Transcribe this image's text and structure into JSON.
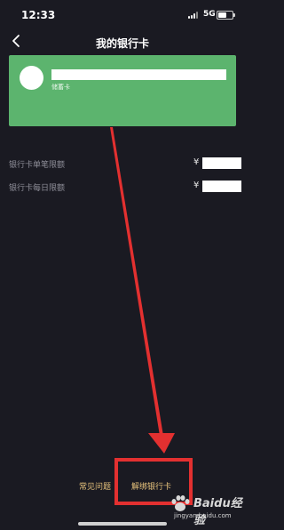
{
  "status_bar": {
    "time": "12:33",
    "network": "5G",
    "battery_level": 0.6
  },
  "nav": {
    "back_icon": "chevron-left-icon",
    "title": "我的银行卡"
  },
  "card": {
    "type_label": "储蓄卡",
    "color": "#5cb46e"
  },
  "limits": [
    {
      "label": "银行卡单笔限额",
      "currency": "¥"
    },
    {
      "label": "银行卡每日限额",
      "currency": "¥"
    }
  ],
  "footer": {
    "faq_label": "常见问题",
    "unbind_label": "解绑银行卡",
    "link_color": "#e7c37c"
  },
  "annotation": {
    "color": "#e33030"
  },
  "watermark": {
    "brand": "Baidu经验",
    "url": "jingyan.baidu.com"
  }
}
